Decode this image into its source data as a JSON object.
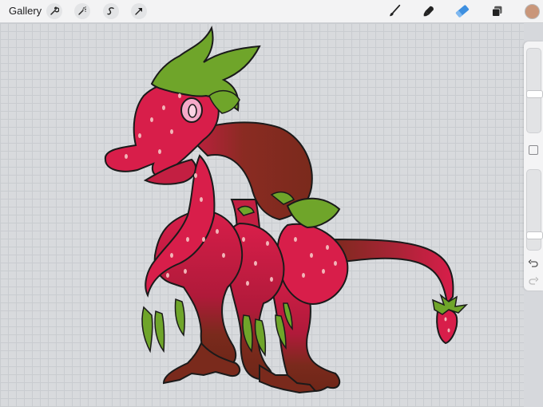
{
  "toolbar": {
    "gallery_label": "Gallery",
    "left_tools": [
      "wrench-icon",
      "magic-wand-icon",
      "selection-s-icon",
      "transform-arrow-icon"
    ],
    "right_tools": [
      "brush-icon",
      "smudge-icon",
      "eraser-icon",
      "layers-icon"
    ],
    "active_tool": "eraser-icon",
    "active_color": "#c9967a"
  },
  "sidebar": {
    "brush_size_level": 0.45,
    "opacity_level": 0.15,
    "undo_icon": "undo-icon",
    "redo_icon": "redo-icon"
  },
  "colors": {
    "canvas_bg": "#d8dadd",
    "strawberry_red": "#d81e4a",
    "leaf_green": "#6fa52a",
    "shadow_brown": "#7a2a1c",
    "seed_pink": "#f2b5b8",
    "eye_pink": "#f5a9c8",
    "eraser_blue": "#3d8fe0"
  }
}
